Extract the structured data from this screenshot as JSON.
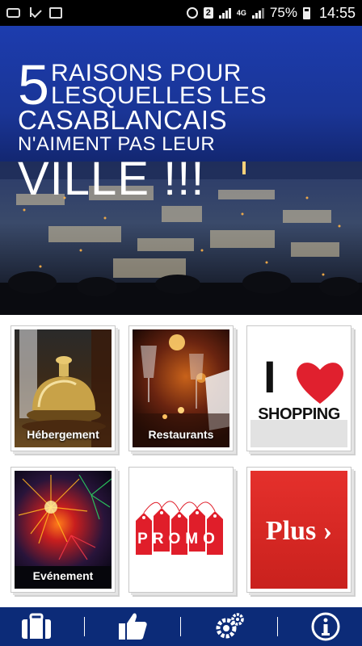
{
  "status_bar": {
    "sim_slot": "2",
    "network": "4G",
    "battery": "75%",
    "time": "14:55"
  },
  "banner": {
    "number": "5",
    "line1": "RAISONS POUR",
    "line2": "LESQUELLES LES",
    "line3": "CASABLANCAIS",
    "line4": "N'AIMENT PAS LEUR",
    "line5": "VILLE !!!"
  },
  "tiles": [
    {
      "label": "Hébergement"
    },
    {
      "label": "Restaurants"
    },
    {
      "label": ""
    },
    {
      "label": "Evénement"
    },
    {
      "label": ""
    },
    {
      "label": ""
    }
  ],
  "shopping": {
    "letter": "I",
    "word": "SHOPPING"
  },
  "promo": {
    "word": "PROMO"
  },
  "plus": {
    "label": "Plus ›"
  },
  "bottom_nav": [
    {
      "icon": "suitcase-icon"
    },
    {
      "icon": "thumbs-up-icon"
    },
    {
      "icon": "gears-icon"
    },
    {
      "icon": "info-icon"
    }
  ],
  "colors": {
    "nav_bar": "#0c2b78",
    "plus_red": "#d62a26",
    "heart_red": "#e0202e"
  }
}
